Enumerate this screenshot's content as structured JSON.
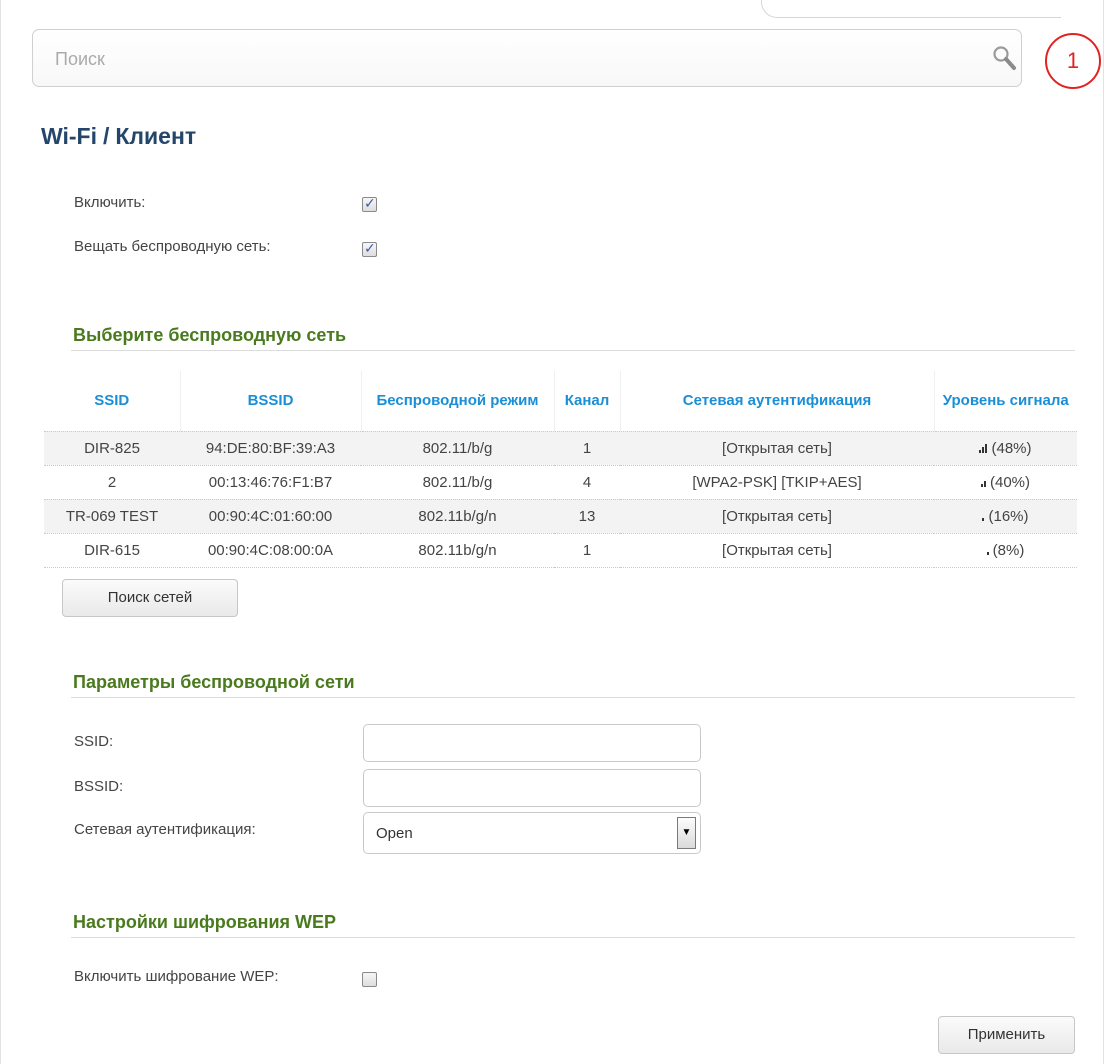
{
  "search": {
    "placeholder": "Поиск"
  },
  "notifications": {
    "count": "1"
  },
  "header": {
    "section": "Wi-Fi",
    "separator": "/",
    "page": "Клиент"
  },
  "general": {
    "enable_label": "Включить:",
    "enable_checked": true,
    "broadcast_label": "Вещать беспроводную сеть:",
    "broadcast_checked": true
  },
  "network_select": {
    "title": "Выберите беспроводную сеть",
    "columns": {
      "ssid": "SSID",
      "bssid": "BSSID",
      "mode": "Беспроводной режим",
      "channel": "Канал",
      "auth": "Сетевая аутентификация",
      "signal": "Уровень сигнала"
    },
    "rows": [
      {
        "ssid": "DIR-825",
        "bssid": "94:DE:80:BF:39:A3",
        "mode": "802.11/b/g",
        "channel": "1",
        "auth": "[Открытая сеть]",
        "signal": "(48%)",
        "bars": 3
      },
      {
        "ssid": "2",
        "bssid": "00:13:46:76:F1:B7",
        "mode": "802.11/b/g",
        "channel": "4",
        "auth": "[WPA2-PSK] [TKIP+AES]",
        "signal": "(40%)",
        "bars": 2
      },
      {
        "ssid": "TR-069 TEST",
        "bssid": "00:90:4C:01:60:00",
        "mode": "802.11b/g/n",
        "channel": "13",
        "auth": "[Открытая сеть]",
        "signal": "(16%)",
        "bars": 1
      },
      {
        "ssid": "DIR-615",
        "bssid": "00:90:4C:08:00:0A",
        "mode": "802.11b/g/n",
        "channel": "1",
        "auth": "[Открытая сеть]",
        "signal": "(8%)",
        "bars": 1
      }
    ],
    "scan_button": "Поиск сетей"
  },
  "wireless_params": {
    "title": "Параметры беспроводной сети",
    "ssid_label": "SSID:",
    "ssid_value": "",
    "bssid_label": "BSSID:",
    "bssid_value": "",
    "auth_label": "Сетевая аутентификация:",
    "auth_value": "Open"
  },
  "wep": {
    "title": "Настройки шифрования WEP",
    "enable_label": "Включить шифрование WEP:",
    "enable_checked": false
  },
  "apply_button": "Применить",
  "colors": {
    "title": "#24466b",
    "section": "#4a7a1e",
    "table_header": "#1a8fd6",
    "badge": "#e32222"
  }
}
